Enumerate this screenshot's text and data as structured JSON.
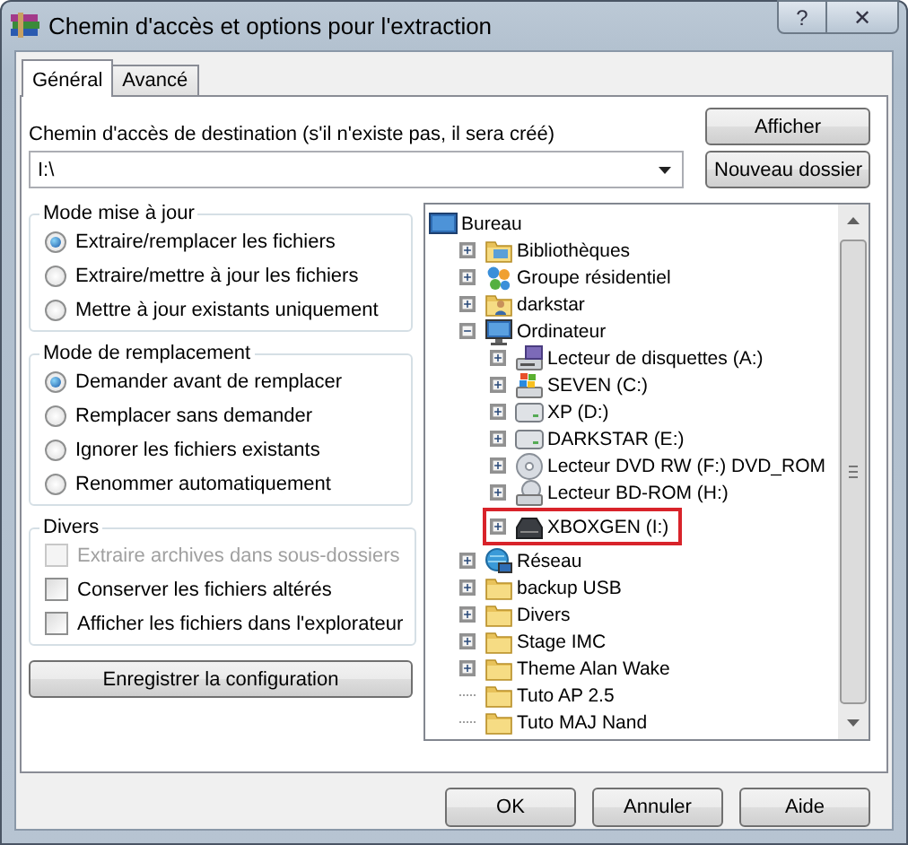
{
  "window": {
    "title": "Chemin d'accès et options pour l'extraction",
    "caption_buttons": [
      "?",
      "✕"
    ]
  },
  "tabs": [
    {
      "label": "Général",
      "selected": true
    },
    {
      "label": "Avancé",
      "selected": false
    }
  ],
  "destination": {
    "label": "Chemin d'accès de destination (s'il n'existe pas, il sera créé)",
    "value": "I:\\"
  },
  "side_buttons": [
    "Afficher",
    "Nouveau dossier"
  ],
  "groups": [
    {
      "title": "Mode mise à jour",
      "items": [
        {
          "kind": "radio",
          "label": "Extraire/remplacer les fichiers",
          "selected": true
        },
        {
          "kind": "radio",
          "label": "Extraire/mettre à jour les fichiers",
          "selected": false
        },
        {
          "kind": "radio",
          "label": "Mettre à jour existants uniquement",
          "selected": false
        }
      ]
    },
    {
      "title": "Mode de remplacement",
      "items": [
        {
          "kind": "radio",
          "label": "Demander avant de remplacer",
          "selected": true
        },
        {
          "kind": "radio",
          "label": "Remplacer sans demander",
          "selected": false
        },
        {
          "kind": "radio",
          "label": "Ignorer les fichiers existants",
          "selected": false
        },
        {
          "kind": "radio",
          "label": "Renommer automatiquement",
          "selected": false
        }
      ]
    },
    {
      "title": "Divers",
      "items": [
        {
          "kind": "checkbox",
          "label": "Extraire archives dans sous-dossiers",
          "checked": false,
          "disabled": true
        },
        {
          "kind": "checkbox",
          "label": "Conserver les fichiers altérés",
          "checked": false,
          "disabled": false
        },
        {
          "kind": "checkbox",
          "label": "Afficher les fichiers dans l'explorateur",
          "checked": false,
          "disabled": false
        }
      ]
    }
  ],
  "save_button": "Enregistrer la configuration",
  "tree": {
    "root": {
      "label": "Bureau",
      "kind": "desktop",
      "children": [
        {
          "label": "Bibliothèques",
          "kind": "library",
          "has_children": true
        },
        {
          "label": "Groupe résidentiel",
          "kind": "homegroup",
          "has_children": true
        },
        {
          "label": "darkstar",
          "kind": "user",
          "has_children": true
        },
        {
          "label": "Ordinateur",
          "kind": "computer",
          "has_children": true,
          "expanded": true,
          "children": [
            {
              "label": "Lecteur de disquettes (A:)",
              "kind": "floppy",
              "has_children": true,
              "highlighted": false
            },
            {
              "label": "SEVEN (C:)",
              "kind": "system-drive",
              "has_children": true,
              "highlighted": false
            },
            {
              "label": "XP (D:)",
              "kind": "drive",
              "has_children": true,
              "highlighted": false
            },
            {
              "label": "DARKSTAR (E:)",
              "kind": "drive",
              "has_children": true,
              "highlighted": false
            },
            {
              "label": "Lecteur DVD RW (F:) DVD_ROM",
              "kind": "disc",
              "has_children": true,
              "highlighted": false
            },
            {
              "label": "Lecteur BD-ROM (H:)",
              "kind": "disc-drive",
              "has_children": true,
              "highlighted": false
            },
            {
              "label": "XBOXGEN (I:)",
              "kind": "removable",
              "has_children": true,
              "highlighted": true
            }
          ]
        },
        {
          "label": "Réseau",
          "kind": "network",
          "has_children": true
        },
        {
          "label": "backup USB",
          "kind": "folder",
          "has_children": true
        },
        {
          "label": "Divers",
          "kind": "folder",
          "has_children": true
        },
        {
          "label": "Stage IMC",
          "kind": "folder",
          "has_children": true
        },
        {
          "label": "Theme Alan Wake",
          "kind": "folder",
          "has_children": true
        },
        {
          "label": "Tuto AP 2.5",
          "kind": "folder",
          "has_children": false
        },
        {
          "label": "Tuto MAJ Nand",
          "kind": "folder",
          "has_children": false
        }
      ]
    }
  },
  "buttons": [
    "OK",
    "Annuler",
    "Aide"
  ]
}
